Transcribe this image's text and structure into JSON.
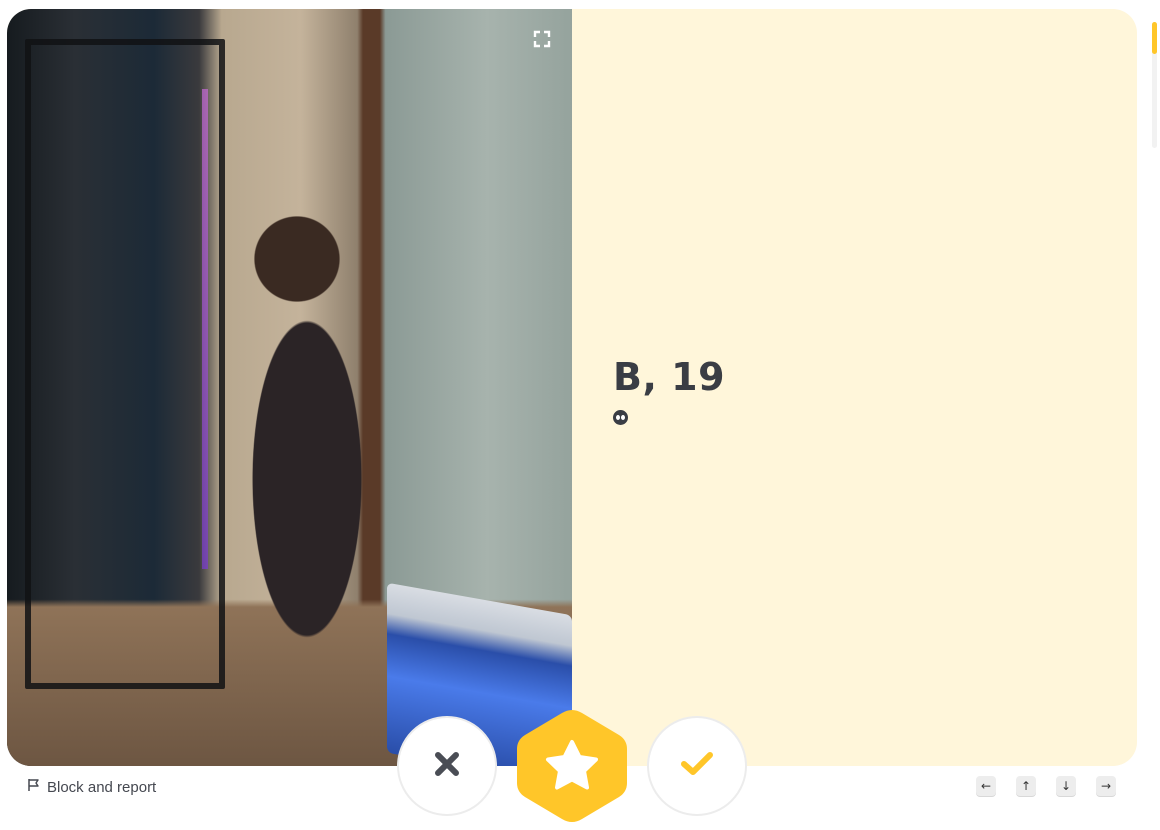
{
  "profile": {
    "name_age": "B, 19",
    "badge_icon": "sign-icon"
  },
  "photo": {
    "alt": "Profile photo",
    "expand_icon": "expand-icon"
  },
  "footer": {
    "block_report_label": "Block and report",
    "flag_icon": "flag-icon"
  },
  "actions": {
    "pass_icon": "close-icon",
    "superswipe_icon": "star-icon",
    "like_icon": "check-icon"
  },
  "keyboard_nav": [
    {
      "name": "left-arrow-key",
      "glyph": "←"
    },
    {
      "name": "up-arrow-key",
      "glyph": "↑"
    },
    {
      "name": "down-arrow-key",
      "glyph": "↓"
    },
    {
      "name": "right-arrow-key",
      "glyph": "→"
    }
  ],
  "colors": {
    "accent": "#FFC629",
    "card_background": "#FFF6DA",
    "text": "#3a3d44"
  }
}
